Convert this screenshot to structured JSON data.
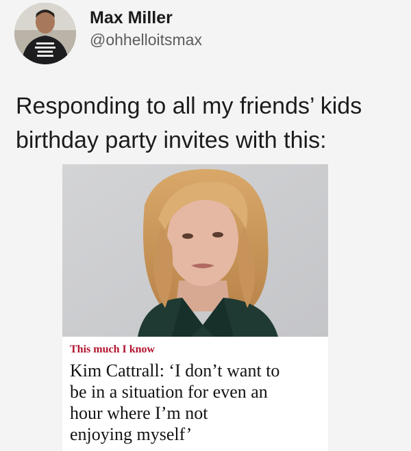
{
  "tweet": {
    "author": {
      "display_name": "Max Miller",
      "handle": "@ohhelloitsmax",
      "avatar_icon": "profile-photo"
    },
    "text_lines": [
      "Responding to all my friends’ kids",
      "birthday party invites with this:"
    ]
  },
  "article_card": {
    "kicker": "This much I know",
    "headline_lines": [
      "Kim Cattrall: ‘I don’t want to",
      "be in a situation for even an",
      "hour where I’m not",
      "enjoying myself’"
    ],
    "colors": {
      "kicker": "#b3132e",
      "headline": "#121212",
      "photo_background": "#cfd0d2"
    }
  }
}
